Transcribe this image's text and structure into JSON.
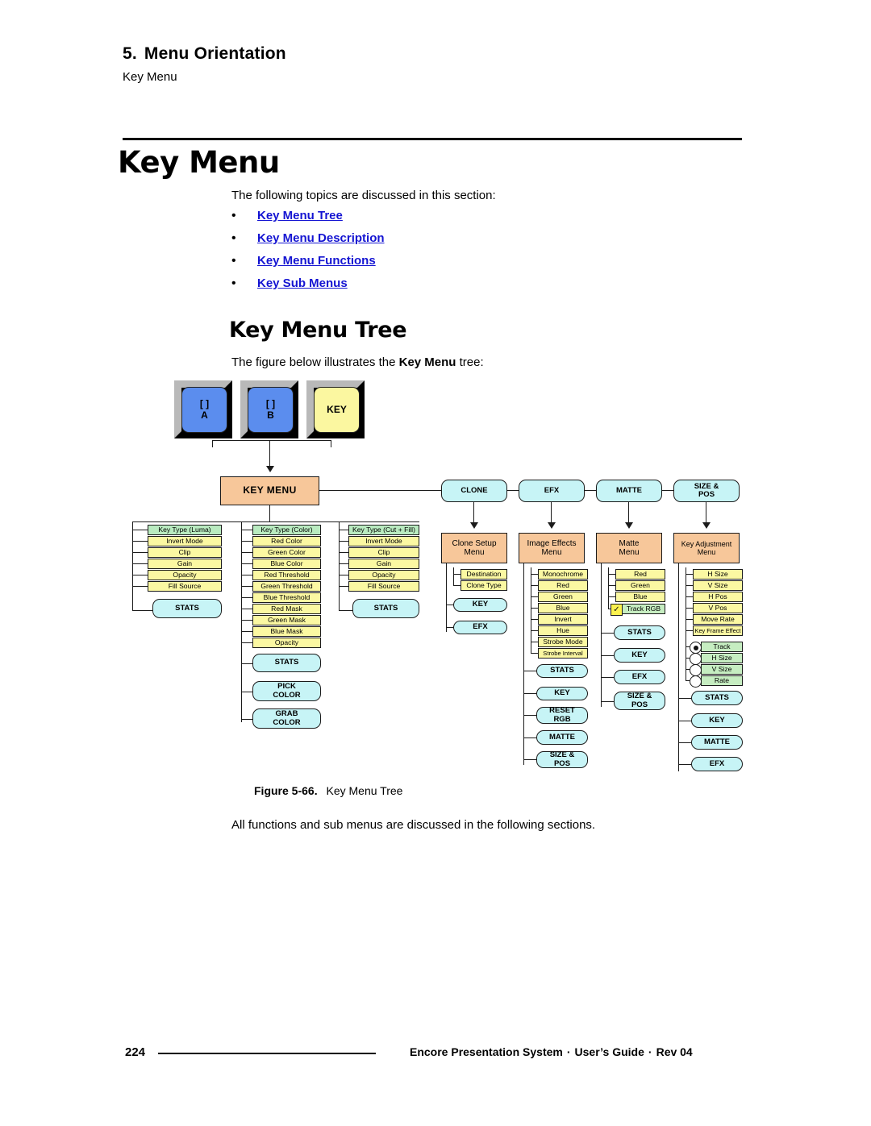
{
  "header": {
    "chapter_number": "5.",
    "chapter_title": "Menu Orientation",
    "subtitle": "Key Menu"
  },
  "page_title": "Key Menu",
  "intro_text": "The following topics are discussed in this section:",
  "topics": [
    {
      "bullet": "•",
      "label": "Key Menu Tree"
    },
    {
      "bullet": "•",
      "label": "Key Menu Description"
    },
    {
      "bullet": "•",
      "label": "Key Menu Functions"
    },
    {
      "bullet": "•",
      "label": "Key Sub Menus"
    }
  ],
  "section_title": "Key Menu Tree",
  "figure_intro_before": "The figure below illustrates the ",
  "figure_intro_bold": "Key Menu",
  "figure_intro_after": " tree:",
  "caption": {
    "label": "Figure 5-66.",
    "text": "Key Menu Tree"
  },
  "closing_text": "All functions and sub menus are discussed in the following sections.",
  "footer": {
    "page_number": "224",
    "product": "Encore Presentation System",
    "doc": "User’s Guide",
    "rev": "Rev 04",
    "separator": "·"
  },
  "colors": {
    "link": "#1414d2",
    "menu_box": "#f7c79a",
    "function_box": "#c7f4f6",
    "param_item": "#fbf8a2",
    "selected_item": "#c6edc1",
    "keycap_blue": "#5b8dee",
    "keycap_yellow": "#fbf7a0",
    "checkbox": "#fbf24e"
  },
  "diagram": {
    "keycaps": [
      {
        "top": "[ ]",
        "bottom": "A",
        "style": "blue"
      },
      {
        "top": "[ ]",
        "bottom": "B",
        "style": "blue"
      },
      {
        "top": "KEY",
        "bottom": "",
        "style": "yellow"
      }
    ],
    "root": "KEY MENU",
    "top_functions": [
      {
        "label": "CLONE"
      },
      {
        "label": "EFX"
      },
      {
        "label": "MATTE"
      },
      {
        "label": "SIZE &\nPOS",
        "line1": "SIZE &",
        "line2": "POS"
      }
    ],
    "columns": [
      {
        "name": "key-type-luma",
        "items": [
          {
            "label": "Key Type (Luma)",
            "selected": true
          },
          {
            "label": "Invert Mode"
          },
          {
            "label": "Clip"
          },
          {
            "label": "Gain"
          },
          {
            "label": "Opacity"
          },
          {
            "label": "Fill Source"
          }
        ],
        "buttons": [
          {
            "label": "STATS"
          }
        ]
      },
      {
        "name": "key-type-color",
        "items": [
          {
            "label": "Key Type (Color)",
            "selected": true
          },
          {
            "label": "Red Color"
          },
          {
            "label": "Green Color"
          },
          {
            "label": "Blue Color"
          },
          {
            "label": "Red Threshold"
          },
          {
            "label": "Green Threshold"
          },
          {
            "label": "Blue Threshold"
          },
          {
            "label": "Red Mask"
          },
          {
            "label": "Green Mask"
          },
          {
            "label": "Blue Mask"
          },
          {
            "label": "Opacity"
          }
        ],
        "buttons": [
          {
            "label": "STATS"
          },
          {
            "line1": "PICK",
            "line2": "COLOR"
          },
          {
            "line1": "GRAB",
            "line2": "COLOR"
          }
        ]
      },
      {
        "name": "key-type-cut-fill",
        "items": [
          {
            "label": "Key Type (Cut + Fill)",
            "selected": true
          },
          {
            "label": "Invert Mode"
          },
          {
            "label": "Clip"
          },
          {
            "label": "Gain"
          },
          {
            "label": "Opacity"
          },
          {
            "label": "Fill Source"
          }
        ],
        "buttons": [
          {
            "label": "STATS"
          }
        ]
      }
    ],
    "branches": [
      {
        "name": "clone",
        "menu_line1": "Clone Setup",
        "menu_line2": "Menu",
        "items": [
          {
            "label": "Destination"
          },
          {
            "label": "Clone Type"
          }
        ],
        "buttons": [
          {
            "label": "KEY"
          },
          {
            "label": "EFX"
          }
        ]
      },
      {
        "name": "efx",
        "menu_line1": "Image Effects",
        "menu_line2": "Menu",
        "items": [
          {
            "label": "Monochrome"
          },
          {
            "label": "Red"
          },
          {
            "label": "Green"
          },
          {
            "label": "Blue"
          },
          {
            "label": "Invert"
          },
          {
            "label": "Hue"
          },
          {
            "label": "Strobe Mode"
          },
          {
            "label": "Strobe Interval"
          }
        ],
        "buttons": [
          {
            "label": "STATS"
          },
          {
            "label": "KEY"
          },
          {
            "line1": "RESET",
            "line2": "RGB"
          },
          {
            "label": "MATTE"
          },
          {
            "line1": "SIZE &",
            "line2": "POS"
          }
        ]
      },
      {
        "name": "matte",
        "menu_line1": "Matte",
        "menu_line2": "Menu",
        "items": [
          {
            "label": "Red"
          },
          {
            "label": "Green"
          },
          {
            "label": "Blue"
          }
        ],
        "checkbox_items": [
          {
            "label": "Track RGB",
            "checked": true,
            "mark": "✓"
          }
        ],
        "buttons": [
          {
            "label": "STATS"
          },
          {
            "label": "KEY"
          },
          {
            "label": "EFX"
          },
          {
            "line1": "SIZE &",
            "line2": "POS"
          }
        ]
      },
      {
        "name": "size-pos",
        "menu_line1": "Key Adjustment",
        "menu_line2": "Menu",
        "items": [
          {
            "label": "H Size"
          },
          {
            "label": "V Size"
          },
          {
            "label": "H Pos"
          },
          {
            "label": "V Pos"
          },
          {
            "label": "Move Rate"
          },
          {
            "label": "Key Frame Effect"
          }
        ],
        "radio_items": [
          {
            "label": "Track",
            "selected": true
          },
          {
            "label": "H Size",
            "selected": false
          },
          {
            "label": "V Size",
            "selected": false
          },
          {
            "label": "Rate",
            "selected": false
          }
        ],
        "buttons": [
          {
            "label": "STATS"
          },
          {
            "label": "KEY"
          },
          {
            "label": "MATTE"
          },
          {
            "label": "EFX"
          }
        ]
      }
    ]
  }
}
